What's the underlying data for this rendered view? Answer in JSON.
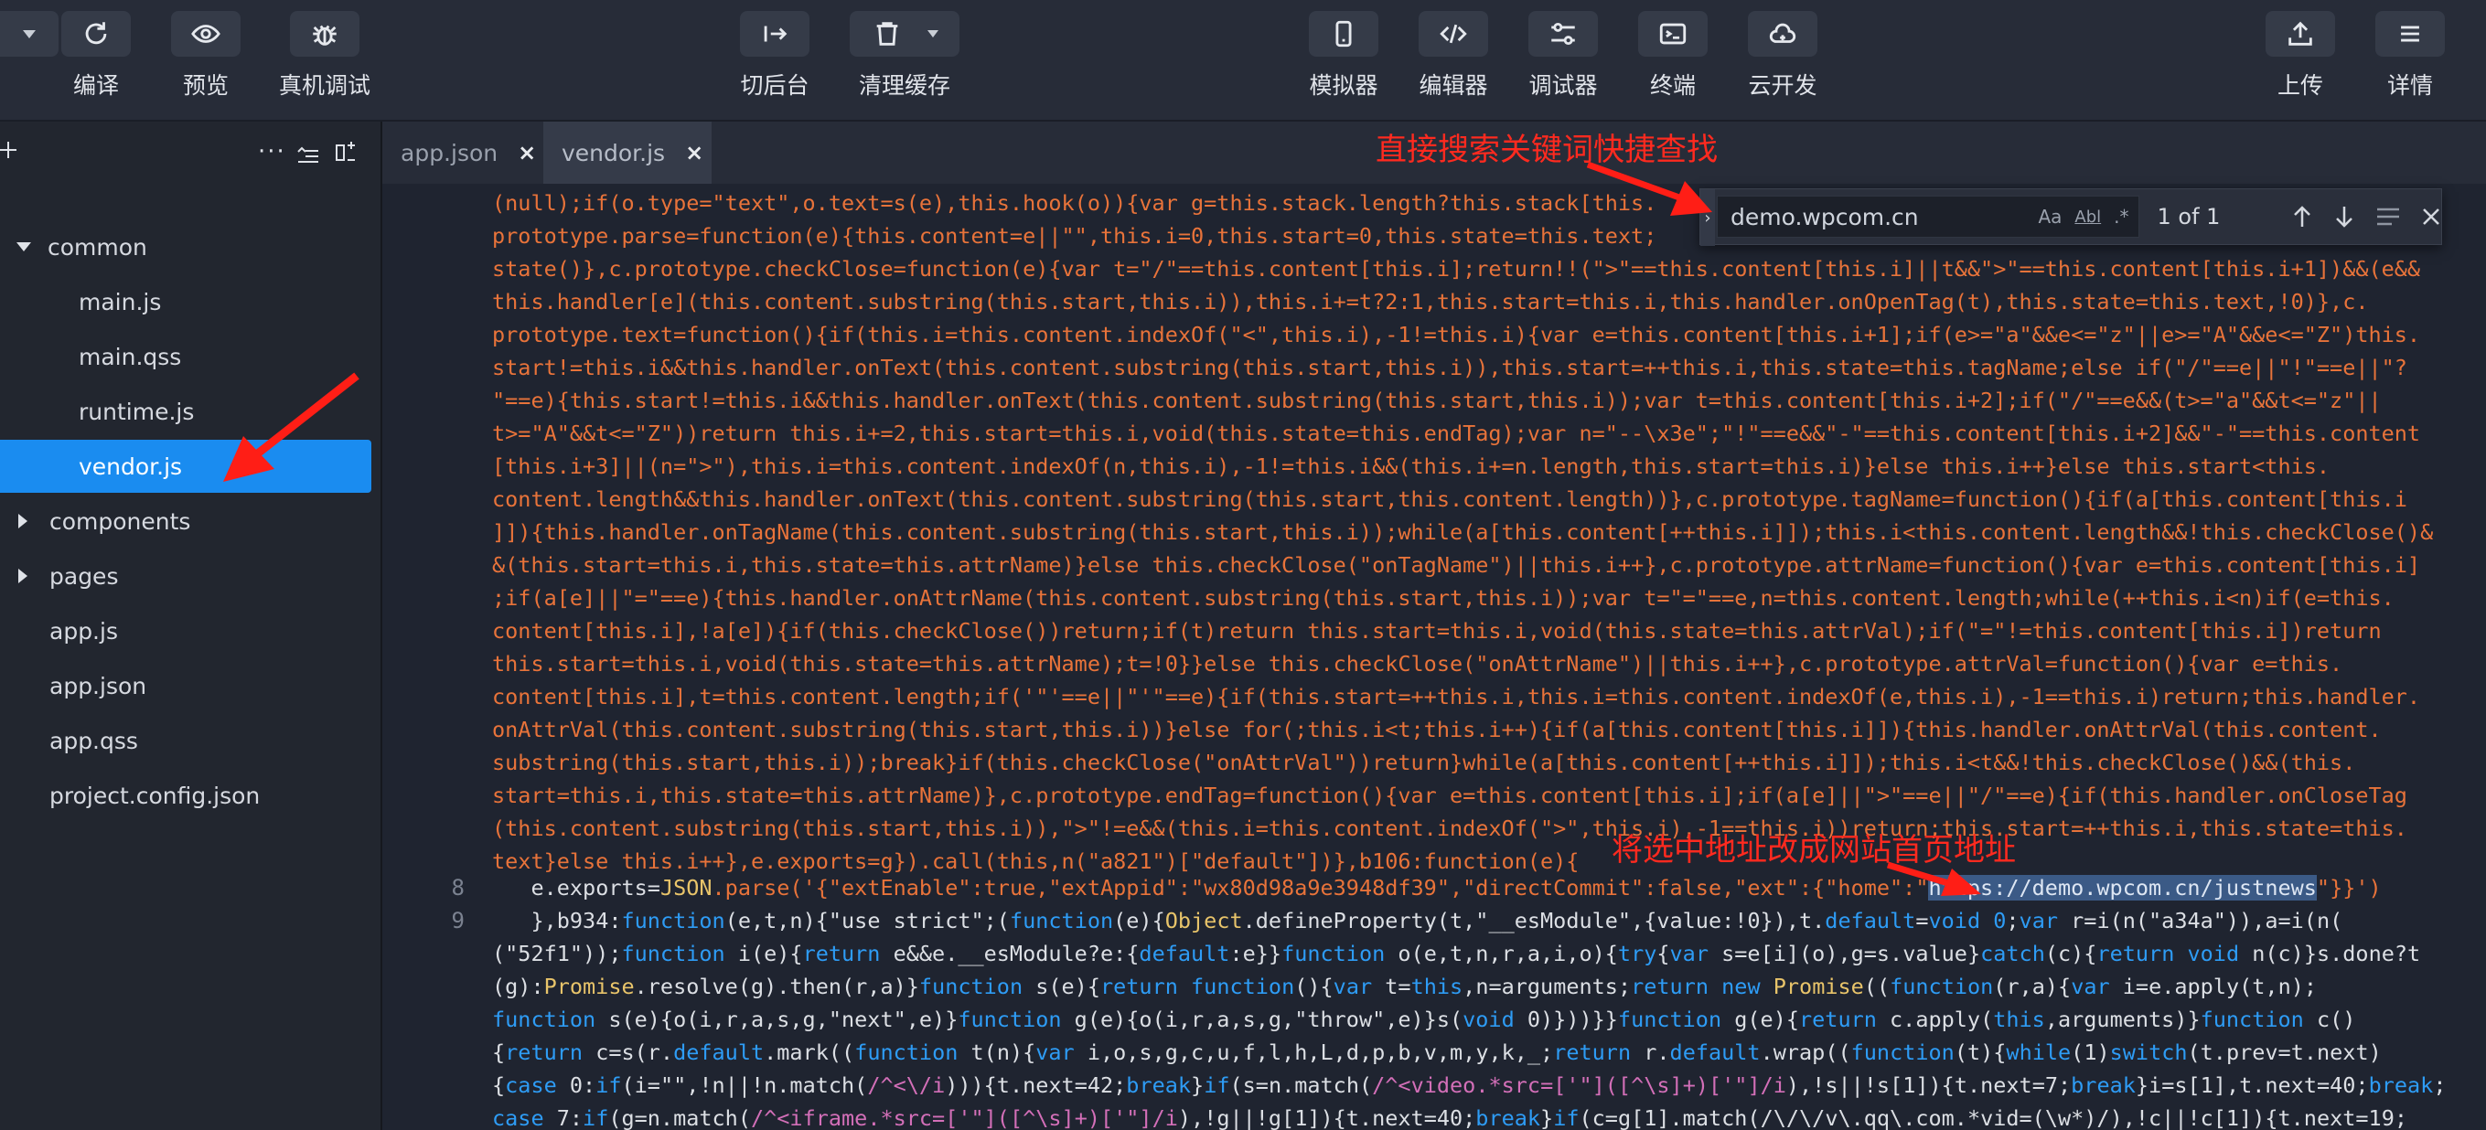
{
  "toolbar": {
    "buttons": [
      {
        "label": "编译",
        "icon": "compile-icon"
      },
      {
        "label": "预览",
        "icon": "eye-icon"
      },
      {
        "label": "真机调试",
        "icon": "bug-icon"
      },
      {
        "label": "切后台",
        "icon": "switch-icon"
      },
      {
        "label": "清理缓存",
        "icon": "trash-icon"
      },
      {
        "label": "模拟器",
        "icon": "phone-icon"
      },
      {
        "label": "编辑器",
        "icon": "code-icon"
      },
      {
        "label": "调试器",
        "icon": "sliders-icon"
      },
      {
        "label": "终端",
        "icon": "terminal-icon"
      },
      {
        "label": "云开发",
        "icon": "cloud-icon"
      },
      {
        "label": "上传",
        "icon": "upload-icon"
      },
      {
        "label": "详情",
        "icon": "menu-icon"
      }
    ]
  },
  "sidebar": {
    "tree": [
      {
        "label": "common",
        "kind": "folder-open"
      },
      {
        "label": "main.js",
        "kind": "file"
      },
      {
        "label": "main.qss",
        "kind": "file"
      },
      {
        "label": "runtime.js",
        "kind": "file"
      },
      {
        "label": "vendor.js",
        "kind": "file",
        "selected": true
      },
      {
        "label": "components",
        "kind": "folder"
      },
      {
        "label": "pages",
        "kind": "folder"
      },
      {
        "label": "app.js",
        "kind": "file"
      },
      {
        "label": "app.json",
        "kind": "file"
      },
      {
        "label": "app.qss",
        "kind": "file"
      },
      {
        "label": "project.config.json",
        "kind": "file"
      }
    ]
  },
  "tabs": [
    {
      "label": "app.json",
      "close": "×"
    },
    {
      "label": "vendor.js",
      "close": "×"
    }
  ],
  "search": {
    "query": "demo.wpcom.cn",
    "case_toggle": "Aa",
    "word_toggle": "Abl",
    "regex_toggle": ".*",
    "result_count": "1 of 1"
  },
  "annotations": {
    "search_hint": "直接搜索关键词快捷查找",
    "replace_hint": "将选中地址改成网站首页地址"
  },
  "editor": {
    "line_numbers": {
      "l8": "8",
      "l9": "9"
    },
    "lines": [
      "(null);if(o.type=\"text\",o.text=s(e),this.hook(o)){var g=this.stack.length?this.stack[this.",
      "prototype.parse=function(e){this.content=e||\"\",this.i=0,this.start=0,this.state=this.text;",
      "state()},c.prototype.checkClose=function(e){var t=\"/\"==this.content[this.i];return!!(\">\"==this.content[this.i]||t&&\">\"==this.content[this.i+1])&&(e&&",
      "this.handler[e](this.content.substring(this.start,this.i)),this.i+=t?2:1,this.start=this.i,this.handler.onOpenTag(t),this.state=this.text,!0)},c.",
      "prototype.text=function(){if(this.i=this.content.indexOf(\"<\",this.i),-1!=this.i){var e=this.content[this.i+1];if(e>=\"a\"&&e<=\"z\"||e>=\"A\"&&e<=\"Z\")this.",
      "start!=this.i&&this.handler.onText(this.content.substring(this.start,this.i)),this.start=++this.i,this.state=this.tagName;else if(\"/\"==e||\"!\"==e||\"?",
      "\"==e){this.start!=this.i&&this.handler.onText(this.content.substring(this.start,this.i));var t=this.content[this.i+2];if(\"/\"==e&&(t>=\"a\"&&t<=\"z\"||",
      "t>=\"A\"&&t<=\"Z\"))return this.i+=2,this.start=this.i,void(this.state=this.endTag);var n=\"--\\x3e\";\"!\"==e&&\"-\"==this.content[this.i+2]&&\"-\"==this.content",
      "[this.i+3]||(n=\">\"),this.i=this.content.indexOf(n,this.i),-1!=this.i&&(this.i+=n.length,this.start=this.i)}else this.i++}else this.start<this.",
      "content.length&&this.handler.onText(this.content.substring(this.start,this.content.length))},c.prototype.tagName=function(){if(a[this.content[this.i",
      "]]){this.handler.onTagName(this.content.substring(this.start,this.i));while(a[this.content[++this.i]]);this.i<this.content.length&&!this.checkClose()&",
      "&(this.start=this.i,this.state=this.attrName)}else this.checkClose(\"onTagName\")||this.i++},c.prototype.attrName=function(){var e=this.content[this.i]",
      ";if(a[e]||\"=\"==e){this.handler.onAttrName(this.content.substring(this.start,this.i));var t=\"=\"==e,n=this.content.length;while(++this.i<n)if(e=this.",
      "content[this.i],!a[e]){if(this.checkClose())return;if(t)return this.start=this.i,void(this.state=this.attrVal);if(\"=\"!=this.content[this.i])return",
      "this.start=this.i,void(this.state=this.attrName);t=!0}}else this.checkClose(\"onAttrName\")||this.i++},c.prototype.attrVal=function(){var e=this.",
      "content[this.i],t=this.content.length;if('\"'==e||\"'\"==e){if(this.start=++this.i,this.i=this.content.indexOf(e,this.i),-1==this.i)return;this.handler.",
      "onAttrVal(this.content.substring(this.start,this.i))}else for(;this.i<t;this.i++){if(a[this.content[this.i]]){this.handler.onAttrVal(this.content.",
      "substring(this.start,this.i));break}if(this.checkClose(\"onAttrVal\"))return}while(a[this.content[++this.i]]);this.i<t&&!this.checkClose()&&(this.",
      "start=this.i,this.state=this.attrName)},c.prototype.endTag=function(){var e=this.content[this.i];if(a[e]||\">\"==e||\"/\"==e){if(this.handler.onCloseTag",
      "(this.content.substring(this.start,this.i)),\">\"!=e&&(this.i=this.content.indexOf(\">\",this.i),-1==this.i))return;this.start=++this.i,this.state=this.",
      "text}else this.i++},e.exports=g}).call(this,n(\"a821\")[\"default\"])},b106:function(e){"
    ],
    "line8": {
      "prefix": "e.exports=",
      "json": "JSON",
      "rest": ".parse('{\"extEnable\":true,\"extAppid\":\"wx80d98a9e3948df39\",\"directCommit\":false,\"ext\":{\"home\":\"",
      "url": "https://demo.wpcom.cn/justnews",
      "suffix": "\"}}')"
    },
    "line9_parts": {
      "p1": "},b934:",
      "k1": "function",
      "p2": "(e,t,n){\"use strict\";(",
      "k2": "function",
      "p3": "(e){",
      "f1": "Object",
      "p4": ".defineProperty(t,\"__esModule\",{value:!0}),t.",
      "k3": "default",
      "p5": "=",
      "k4": "void 0",
      "p6": ";",
      "k5": "var",
      "p7": " r=i(n(\"a34a\")),a=i(n("
    },
    "tail_lines": [
      "(\"52f1\"));function i(e){return e&&e.__esModule?e:{default:e}}function o(e,t,n,r,a,i,o){try{var s=e[i](o),g=s.value}catch(c){return void n(c)}s.done?t",
      "(g):Promise.resolve(g).then(r,a)}function s(e){return function(){var t=this,n=arguments;return new Promise((function(r,a){var i=e.apply(t,n);",
      "function s(e){o(i,r,a,s,g,\"next\",e)}function g(e){o(i,r,a,s,g,\"throw\",e)}s(void 0)}))}}function g(e){return c.apply(this,arguments)}function c()",
      "{return c=s(r.default.mark((function t(n){var i,o,s,g,c,u,f,l,h,L,d,p,b,v,m,y,k,_;return r.default.wrap((function(t){while(1)switch(t.prev=t.next)",
      "{case 0:if(i=\"\",!n||!n.match(/^<\\/i))){t.next=42;break}if(s=n.match(/^<video.*src=['\"]([^\\s]+)['\"]/i),!s||!s[1]){t.next=7;break}i=s[1],t.next=40;break;",
      "case 7:if(g=n.match(/^<iframe.*src=['\"]([^\\s]+)['\"]/i),!g||!g[1]){t.next=40;break}if(c=g[1].match(/\\/\\/v\\.qq\\.com.*vid=(\\w*)/),!c||!c[1]){t.next=19;"
    ]
  },
  "colors": {
    "accent": "#1a8cf0",
    "code_orange": "#e8733a",
    "keyword_blue": "#2e9cf5",
    "annotation_red": "#ff2a1f"
  }
}
